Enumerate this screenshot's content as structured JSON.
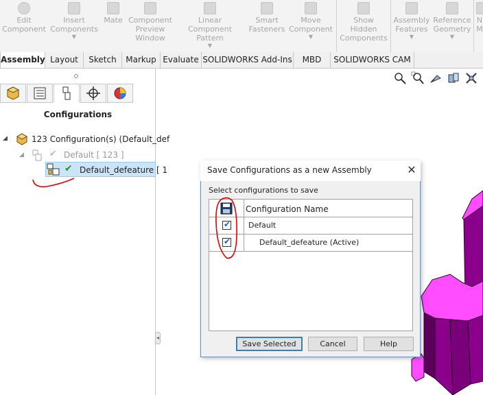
{
  "ribbon": {
    "buttons": [
      {
        "label": "Edit\nComponent",
        "icon": "edit-component-icon"
      },
      {
        "label": "Insert\nComponents",
        "icon": "insert-components-icon"
      },
      {
        "label": "Mate",
        "icon": "mate-icon"
      },
      {
        "label": "Component\nPreview\nWindow",
        "icon": "component-preview-icon"
      },
      {
        "label": "Linear Component\nPattern",
        "icon": "linear-pattern-icon"
      },
      {
        "label": "Smart\nFasteners",
        "icon": "smart-fasteners-icon"
      },
      {
        "label": "Move\nComponent",
        "icon": "move-component-icon"
      },
      {
        "label": "Show\nHidden\nComponents",
        "icon": "show-hidden-icon"
      },
      {
        "label": "Assembly\nFeatures",
        "icon": "assembly-features-icon"
      },
      {
        "label": "Reference\nGeometry",
        "icon": "reference-geometry-icon"
      },
      {
        "label": "N\nM",
        "icon": "more-icon"
      }
    ]
  },
  "tabs": [
    {
      "label": "Assembly",
      "active": true
    },
    {
      "label": "Layout"
    },
    {
      "label": "Sketch"
    },
    {
      "label": "Markup"
    },
    {
      "label": "Evaluate"
    },
    {
      "label": "SOLIDWORKS Add-Ins"
    },
    {
      "label": "MBD"
    },
    {
      "label": "SOLIDWORKS CAM"
    }
  ],
  "panel": {
    "header": "Configurations",
    "tree": {
      "root": "123 Configuration(s)  (Default_def",
      "child": "Default [ 123 ]",
      "selected": "Default_defeature [ 1"
    }
  },
  "dialog": {
    "title": "Save Configurations as a new Assembly",
    "prompt": "Select configurations to save",
    "column_header": "Configuration Name",
    "rows": [
      {
        "name": "Default",
        "checked": true
      },
      {
        "name": "Default_defeature (Active)",
        "checked": true
      }
    ],
    "buttons": {
      "save": "Save Selected",
      "cancel": "Cancel",
      "help": "Help"
    },
    "close_glyph": "✕"
  },
  "colors": {
    "part_face": "#ff4dff",
    "part_side": "#8b008b",
    "part_dark": "#5a005a",
    "annotation_red": "#e00000",
    "selection": "#cce4f7",
    "accent": "#3c7fb1"
  }
}
